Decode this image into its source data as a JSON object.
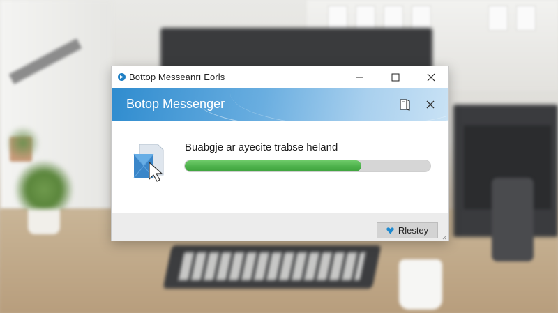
{
  "window": {
    "title": "Bottop Messeanrı Eorls",
    "app_icon": "app-logo-icon",
    "controls": [
      "minimize-icon",
      "maximize-icon",
      "close-icon"
    ]
  },
  "banner": {
    "title": "Botop Messenger",
    "icons": [
      "book-icon",
      "close-icon"
    ],
    "accent": "#2f8ccf"
  },
  "content": {
    "status_text": "Buabgje ar ayecite trabse heland",
    "progress_fraction": 0.72,
    "progress_color": "#4db14b",
    "icon": "document-cursor-icon"
  },
  "footer": {
    "button_label": "Rlestey",
    "button_icon": "heart-icon",
    "button_icon_color": "#1f8ad0"
  }
}
